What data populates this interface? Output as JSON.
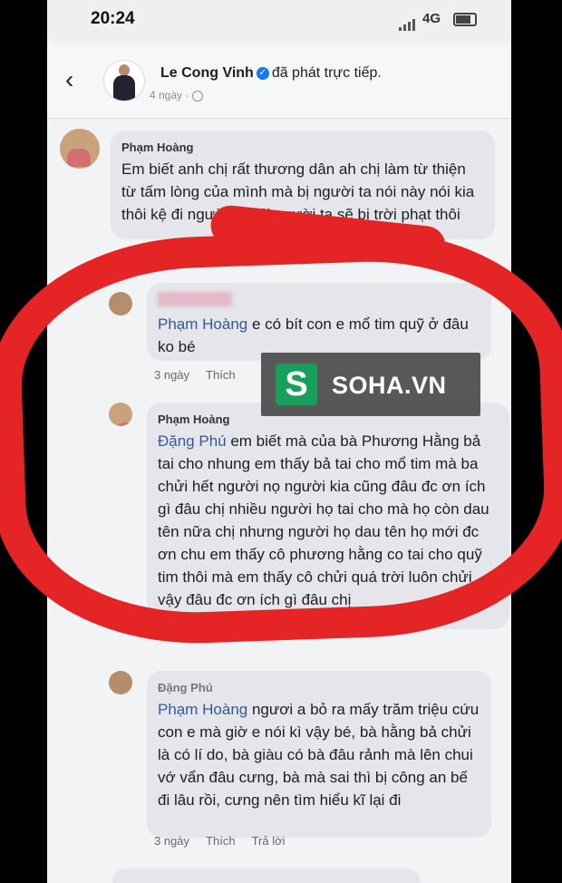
{
  "status": {
    "time": "20:24",
    "network": "4G"
  },
  "post": {
    "author": "Le Cong Vinh",
    "action": "đã phát trực tiếp.",
    "age": "4 ngày ·"
  },
  "comments": [
    {
      "author": "Phạm Hoàng",
      "text": "Em biết anh chị rất thương dân ah chị làm từ thiện từ tấm lòng của mình mà bị người ta nói này nói kia thôi kệ đi người ta nói người ta sẽ bị trời phạt thôi"
    },
    {
      "author": "Đặng Phú",
      "mention": "Phạm Hoàng",
      "text": " e có bít con e mổ tim quỹ ở đâu ko bé",
      "time": "3 ngày",
      "like": "Thích"
    },
    {
      "author": "Phạm Hoàng",
      "mention": "Đặng Phú",
      "text": " em biết mà của bà Phương Hằng bả tai cho nhung em thấy bả tai cho mổ tim mà ba chửi hết người nọ người kia cũng đâu đc ơn ích gì đâu chị nhiều người họ tai cho mà họ còn dau tên nữa chị nhưng người họ dau tên họ mới đc ơn chu em thấy cô phương hằng co tai cho quỹ tim thôi mà em thấy cô chửi quá trời luôn chửi vậy đâu đc ơn ích gì đâu chị"
    },
    {
      "author": "Đặng Phú",
      "mention": "Phạm Hoàng",
      "text": " ngươi a bỏ ra mấy trăm triệu cứu con e mà giờ e nói kì vậy bé, bà hằng bả chửi là có lí do, bà giàu có bà đâu rảnh mà lên chui vớ vẩn đâu cưng, bà mà sai thì bị công an bế đi lâu rồi, cưng nên tìm hiểu kĩ lại đi",
      "time": "3 ngày",
      "like": "Thích",
      "reply": "Trả lời"
    }
  ],
  "watermark": {
    "logo": "S",
    "text": "SOHA.VN",
    "color": "#18a05b"
  },
  "colors": {
    "annotation_red": "#e52525",
    "mention": "#385898"
  }
}
